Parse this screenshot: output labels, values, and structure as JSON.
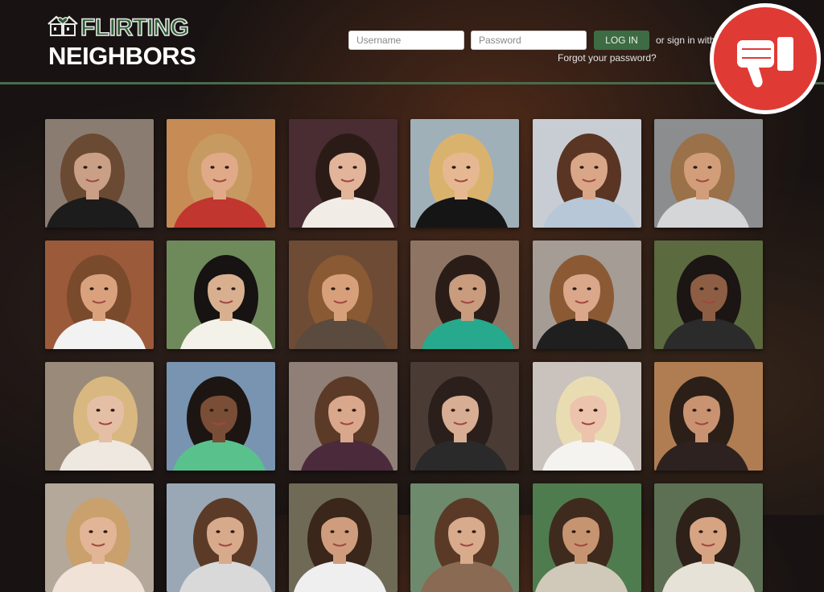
{
  "brand": {
    "line1": "FLIRTING",
    "line2": "NEIGHBORS",
    "accent_color": "#3d6b43"
  },
  "login": {
    "username_placeholder": "Username",
    "password_placeholder": "Password",
    "login_label": "LOG IN",
    "signin_text": "or sign in with",
    "forgot_text": "Forgot your password?"
  },
  "badge": {
    "icon": "thumbs-down-icon",
    "color": "#e03a35"
  },
  "profiles": [
    {
      "bg": "#8a7c70",
      "skin": "#c9a086",
      "hair": "#6b4a33",
      "top": "#1c1c1c"
    },
    {
      "bg": "#c78b55",
      "skin": "#e0a987",
      "hair": "#c79a62",
      "top": "#c1362f"
    },
    {
      "bg": "#4a2c33",
      "skin": "#e2b49a",
      "hair": "#2b1b16",
      "top": "#f1ece6"
    },
    {
      "bg": "#9fb0b9",
      "skin": "#e6b891",
      "hair": "#d9b36d",
      "top": "#151515"
    },
    {
      "bg": "#c8cdd4",
      "skin": "#d9a788",
      "hair": "#5a3524",
      "top": "#b7c7d8"
    },
    {
      "bg": "#8c8d8f",
      "skin": "#d29e7a",
      "hair": "#9a7148",
      "top": "#d4d6d8"
    },
    {
      "bg": "#9b5a3a",
      "skin": "#d9a27d",
      "hair": "#7a4a2c",
      "top": "#f2f2f2"
    },
    {
      "bg": "#6f8a5a",
      "skin": "#d8b090",
      "hair": "#161312",
      "top": "#f4f1e9"
    },
    {
      "bg": "#6d4b34",
      "skin": "#d7a07b",
      "hair": "#8a5a34",
      "top": "#5b4a3e"
    },
    {
      "bg": "#8e7462",
      "skin": "#c99c7e",
      "hair": "#2a1d18",
      "top": "#27a98d"
    },
    {
      "bg": "#a49c95",
      "skin": "#dba78a",
      "hair": "#8b5a35",
      "top": "#1f1f1f"
    },
    {
      "bg": "#5b6a3f",
      "skin": "#8d5e43",
      "hair": "#1b1513",
      "top": "#2b2b2b"
    },
    {
      "bg": "#9a8a79",
      "skin": "#e5bfa5",
      "hair": "#d8b880",
      "top": "#efe8e0"
    },
    {
      "bg": "#7894b0",
      "skin": "#7a4e36",
      "hair": "#1d1512",
      "top": "#59c28c"
    },
    {
      "bg": "#8f7f76",
      "skin": "#d9a78b",
      "hair": "#5b3a27",
      "top": "#4b2b3b"
    },
    {
      "bg": "#4a3c35",
      "skin": "#d7ad94",
      "hair": "#2a1f1b",
      "top": "#2a2a2a"
    },
    {
      "bg": "#c9c2bd",
      "skin": "#ecc3ac",
      "hair": "#eadcb2",
      "top": "#f5f3ef"
    },
    {
      "bg": "#b07d52",
      "skin": "#c99270",
      "hair": "#2b1f18",
      "top": "#2d2220"
    },
    {
      "bg": "#b4a89a",
      "skin": "#e2b597",
      "hair": "#caa06c",
      "top": "#f1e2d8"
    },
    {
      "bg": "#9aa8b6",
      "skin": "#d8aa8c",
      "hair": "#5b3b28",
      "top": "#d9d9d9"
    },
    {
      "bg": "#6e6a56",
      "skin": "#cf9d7d",
      "hair": "#3a261a",
      "top": "#efefef"
    },
    {
      "bg": "#6e8a6c",
      "skin": "#d8ab8c",
      "hair": "#5a3a27",
      "top": "#8a6a52"
    },
    {
      "bg": "#4f7c4e",
      "skin": "#c79472",
      "hair": "#3f2b1d",
      "top": "#d0c9b9"
    },
    {
      "bg": "#5d7054",
      "skin": "#d6a383",
      "hair": "#2d2119",
      "top": "#e6e2d8"
    }
  ]
}
